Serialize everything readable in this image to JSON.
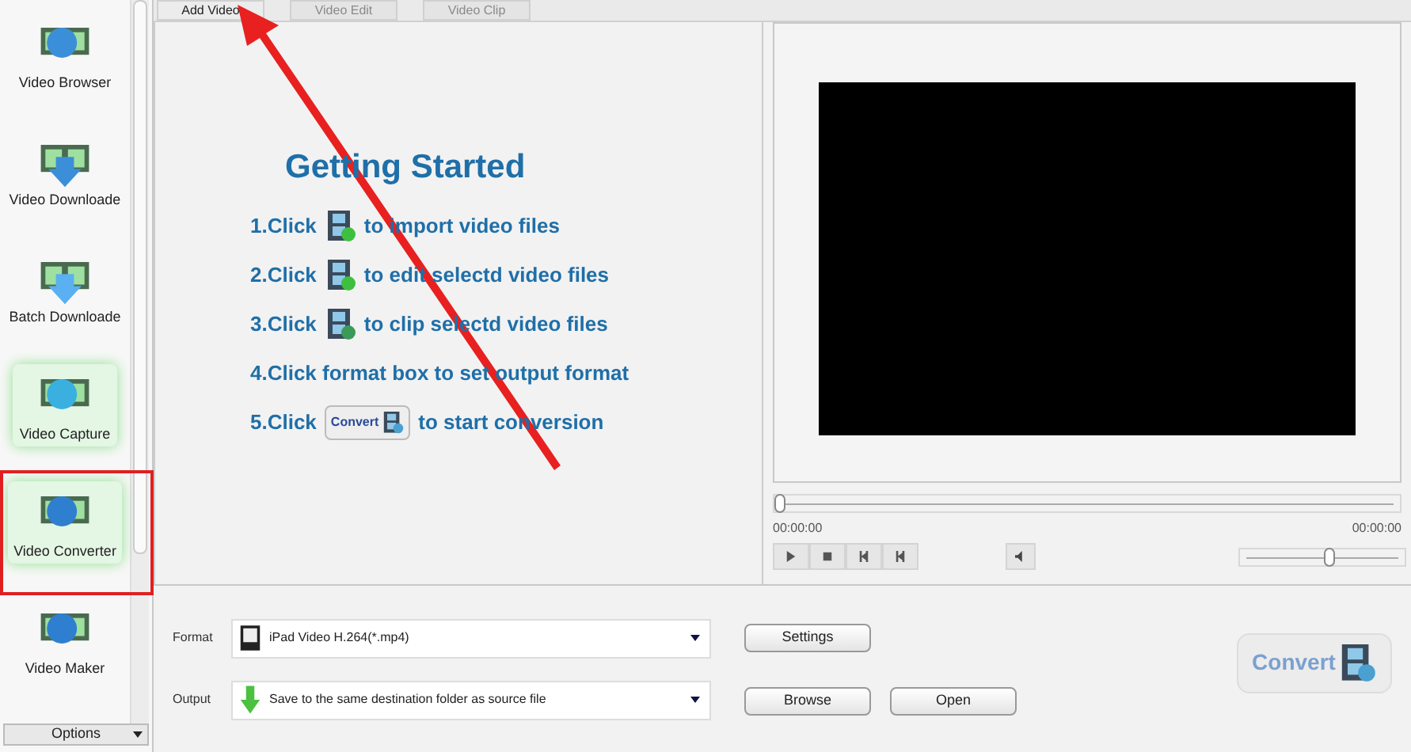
{
  "sidebar": {
    "items": [
      {
        "label": "Video Browser",
        "kind": "browser",
        "selected": false,
        "highlighted": false
      },
      {
        "label": "Video Downloade",
        "kind": "download",
        "selected": false,
        "highlighted": false
      },
      {
        "label": "Batch Downloade",
        "kind": "batch",
        "selected": false,
        "highlighted": false
      },
      {
        "label": "Video Capture",
        "kind": "capture",
        "selected": true,
        "highlighted": false
      },
      {
        "label": "Video Converter",
        "kind": "converter",
        "selected": true,
        "highlighted": true
      },
      {
        "label": "Video Maker",
        "kind": "maker",
        "selected": false,
        "highlighted": false
      }
    ],
    "options": "Options"
  },
  "toolbar": [
    {
      "label": "Add Video",
      "disabled": false
    },
    {
      "label": "Video Edit",
      "disabled": true
    },
    {
      "label": "Video Clip",
      "disabled": true
    }
  ],
  "getting_started": {
    "title": "Getting Started",
    "steps": [
      {
        "prefix": "1.Click",
        "kind": "add",
        "text": "to import video files"
      },
      {
        "prefix": "2.Click",
        "kind": "edit",
        "text": "to edit selectd video files"
      },
      {
        "prefix": "3.Click",
        "kind": "clip",
        "text": "to clip selectd video files"
      },
      {
        "prefix": "4.Click format box to set output format",
        "kind": "plain"
      },
      {
        "prefix": "5.Click",
        "kind": "convert",
        "button": "Convert",
        "text": "to start conversion"
      }
    ]
  },
  "player": {
    "seek": {
      "level": 0
    },
    "current_time": "00:00:00",
    "total_time": "00:00:00",
    "volume": {
      "level": 0.55
    }
  },
  "format": {
    "label": "Format",
    "value": "iPad Video H.264(*.mp4)",
    "button": "Settings"
  },
  "output": {
    "label": "Output",
    "value": "Save to the same destination folder as source file",
    "buttons": [
      "Browse",
      "Open"
    ]
  },
  "convert_button": "Convert",
  "annotation": {
    "arrow": true
  }
}
